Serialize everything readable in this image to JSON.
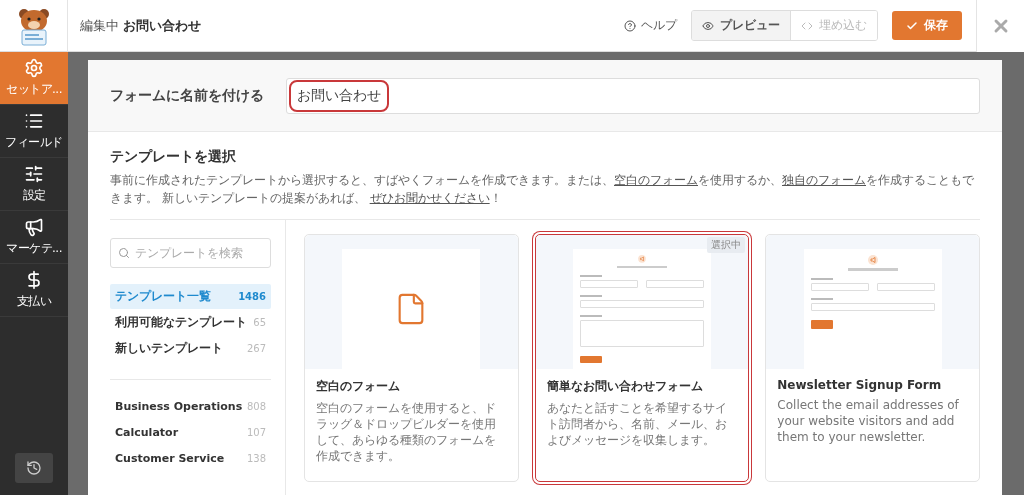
{
  "header": {
    "title_prefix": "編集中",
    "title": "お問い合わせ",
    "help": "ヘルプ",
    "tabs": [
      {
        "label": "プレビュー",
        "kind": "preview",
        "disabled": false
      },
      {
        "label": "埋め込む",
        "kind": "embed",
        "disabled": true
      }
    ],
    "save": "保存"
  },
  "sidebar": {
    "items": [
      {
        "label": "セットア...",
        "kind": "setup",
        "selected": true
      },
      {
        "label": "フィールド",
        "kind": "fields",
        "selected": false
      },
      {
        "label": "設定",
        "kind": "settings",
        "selected": false
      },
      {
        "label": "マーケテ...",
        "kind": "marketing",
        "selected": false
      },
      {
        "label": "支払い",
        "kind": "payments",
        "selected": false
      }
    ]
  },
  "name_field": {
    "label": "フォームに名前を付ける",
    "value": "お問い合わせ",
    "highlighted": true
  },
  "templates": {
    "heading": "テンプレートを選択",
    "description": [
      {
        "text": "事前に作成されたテンプレートから選択すると、すばやくフォームを作成できます。または、",
        "link": false
      },
      {
        "text": "空白のフォーム",
        "link": true
      },
      {
        "text": "を使用するか、",
        "link": false
      },
      {
        "text": "独自のフォーム",
        "link": true
      },
      {
        "text": "を作成することもできます。 新しいテンプレートの提案があれば、 ",
        "link": false
      },
      {
        "text": "ぜひお聞かせください",
        "link": true
      },
      {
        "text": "！",
        "link": false
      }
    ],
    "search": {
      "placeholder": "テンプレートを検索"
    },
    "categories": [
      {
        "label": "テンプレート一覧",
        "count": "1486",
        "selected": true
      },
      {
        "label": "利用可能なテンプレート",
        "count": "65",
        "selected": false
      },
      {
        "label": "新しいテンプレート",
        "count": "267",
        "selected": false
      }
    ],
    "industries": [
      {
        "label": "Business Operations",
        "count": "808"
      },
      {
        "label": "Calculator",
        "count": "107"
      },
      {
        "label": "Customer Service",
        "count": "138"
      }
    ],
    "cards": [
      {
        "kind": "blank",
        "title": "空白のフォーム",
        "description": "空白のフォームを使用すると、ドラッグ＆ドロップビルダーを使用して、あらゆる種類のフォームを作成できます。",
        "selected": false
      },
      {
        "kind": "form",
        "title": "簡単なお問い合わせフォーム",
        "description": "あなたと話すことを希望するサイト訪問者から、名前、メール、およびメッセージを収集します。",
        "selected": true,
        "badge": "選択中",
        "preview": {
          "fields": [
            {
              "kind": "name"
            },
            {
              "kind": "text"
            },
            {
              "kind": "textarea"
            }
          ]
        }
      },
      {
        "kind": "form",
        "title": "Newsletter Signup Form",
        "description": "Collect the email addresses of your website visitors and add them to your newsletter.",
        "selected": false,
        "preview": {
          "fields": [
            {
              "kind": "name"
            },
            {
              "kind": "text"
            }
          ]
        }
      }
    ]
  }
}
